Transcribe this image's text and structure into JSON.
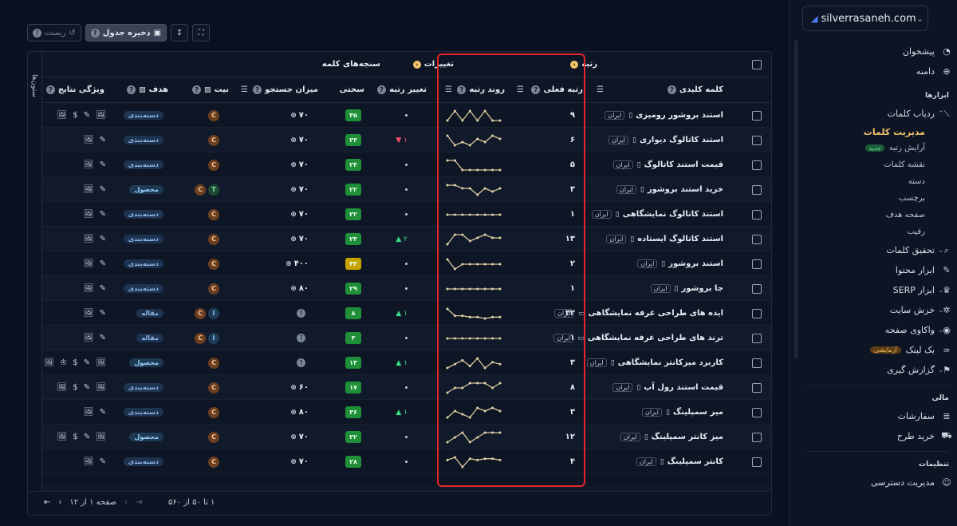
{
  "site": {
    "name": "silverrasaneh.com"
  },
  "sidebar": {
    "top_items": [
      {
        "label": "پیشخوان",
        "icon": "pie-chart-icon"
      },
      {
        "label": "دامنه",
        "icon": "globe-icon"
      }
    ],
    "tools_section": "ابزارها",
    "keyword_tracker": {
      "label": "ردیاب کلمات",
      "icon": "chart-line-icon",
      "subitems": [
        {
          "label": "مدیریت کلمات",
          "active": true
        },
        {
          "label": "آرایش رتبه",
          "badge": "جدید"
        },
        {
          "label": "نقشه کلمات"
        },
        {
          "label": "دسته"
        },
        {
          "label": "برچسب"
        },
        {
          "label": "صفحه هدف"
        },
        {
          "label": "رقیب"
        }
      ]
    },
    "tool_items": [
      {
        "label": "تحقیق کلمات",
        "icon": "search-icon",
        "caret": true
      },
      {
        "label": "ابزار محتوا",
        "icon": "pen-icon",
        "caret": false
      },
      {
        "label": "ابزار SERP",
        "icon": "trophy-icon",
        "caret": true
      },
      {
        "label": "خزش سایت",
        "icon": "spider-icon",
        "caret": true
      },
      {
        "label": "واکاوی صفحه",
        "icon": "gauge-icon",
        "caret": true
      },
      {
        "label": "بک لینک",
        "icon": "link-icon",
        "caret": false,
        "badge": "آزمایشی"
      },
      {
        "label": "گزارش گیری",
        "icon": "flag-icon",
        "caret": true
      }
    ],
    "finance_section": "مالی",
    "finance_items": [
      {
        "label": "سفارشات",
        "icon": "list-icon"
      },
      {
        "label": "خرید طرح",
        "icon": "cart-icon"
      }
    ],
    "settings_section": "تنظیمات",
    "settings_items": [
      {
        "label": "مدیریت دسترسی",
        "icon": "users-icon"
      }
    ]
  },
  "toolbar": {
    "reset_label": "ریست",
    "save_label": "ذخیره جدول"
  },
  "table": {
    "columns_tab": "ستون‌ها",
    "groups": {
      "rank": "رتبه",
      "changes": "تغییرات",
      "metrics": "سنجه‌های کلمه"
    },
    "headers": {
      "keyword": "کلمه کلیدی",
      "current_rank": "رتبه فعلی",
      "rank_trend": "روند رتبه",
      "rank_change": "تغییر رتبه",
      "difficulty": "سختی",
      "search_volume": "میزان جستجو",
      "intent": "نیت",
      "target": "هدف",
      "serp_features": "ویژگی نتایج"
    },
    "rows": [
      {
        "keyword": "استند بروشور رومیزی",
        "location": "ایران",
        "device": "mobile",
        "rank": "۹",
        "change": "•",
        "dir": "none",
        "kd": "۴۵",
        "kdcolor": "#1f8f3a",
        "volume": "۷۰",
        "intent": [
          "C"
        ],
        "target": "دسته‌بندی",
        "target_type": "cat",
        "features": "🖼 ✎ $ 🖼",
        "trend": [
          9,
          8,
          9,
          8,
          9,
          8,
          9,
          9
        ]
      },
      {
        "keyword": "استند کاتالوگ دیواری",
        "location": "ایران",
        "device": "mobile",
        "rank": "۶",
        "change": "۱",
        "dir": "down",
        "kd": "۲۳",
        "kdcolor": "#1f8f3a",
        "volume": "۷۰",
        "intent": [
          "C"
        ],
        "target": "دسته‌بندی",
        "target_type": "cat",
        "features": "✎ 🖼",
        "trend": [
          5,
          8,
          7,
          8,
          6,
          7,
          5,
          6
        ]
      },
      {
        "keyword": "قیمت استند کاتالوگ",
        "location": "ایران",
        "device": "mobile",
        "rank": "۵",
        "change": "•",
        "dir": "none",
        "kd": "۲۴",
        "kdcolor": "#1f8f3a",
        "volume": "۷۰",
        "intent": [
          "C"
        ],
        "target": "دسته‌بندی",
        "target_type": "cat",
        "features": "✎ 🖼",
        "trend": [
          2,
          2,
          6,
          6,
          6,
          6,
          6,
          6
        ]
      },
      {
        "keyword": "خرید استند بروشور",
        "location": "ایران",
        "device": "mobile",
        "rank": "۳",
        "change": "•",
        "dir": "none",
        "kd": "۲۲",
        "kdcolor": "#1f8f3a",
        "volume": "۷۰",
        "intent": [
          "T",
          "C"
        ],
        "target": "محصول",
        "target_type": "prod",
        "features": "✎ 🖼",
        "trend": [
          3,
          3,
          4,
          4,
          6,
          4,
          5,
          4
        ]
      },
      {
        "keyword": "استند کاتالوگ نمایشگاهی",
        "location": "ایران",
        "device": "mobile",
        "rank": "۱",
        "change": "•",
        "dir": "none",
        "kd": "۲۲",
        "kdcolor": "#1f8f3a",
        "volume": "۷۰",
        "intent": [
          "C"
        ],
        "target": "دسته‌بندی",
        "target_type": "cat",
        "features": "✎ 🖼",
        "trend": [
          1,
          1,
          1,
          1,
          1,
          1,
          1,
          1
        ]
      },
      {
        "keyword": "استند کاتالوگ ایستاده",
        "location": "ایران",
        "device": "mobile",
        "rank": "۱۳",
        "change": "۲",
        "dir": "up",
        "kd": "۲۴",
        "kdcolor": "#1f8f3a",
        "volume": "۷۰",
        "intent": [
          "C"
        ],
        "target": "دسته‌بندی",
        "target_type": "cat",
        "features": "✎ 🖼",
        "trend": [
          15,
          12,
          12,
          14,
          13,
          12,
          13,
          13
        ]
      },
      {
        "keyword": "استند بروشور",
        "location": "ایران",
        "device": "mobile",
        "rank": "۲",
        "change": "•",
        "dir": "none",
        "kd": "۳۳",
        "kdcolor": "#c9a400",
        "volume": "۴۰۰",
        "intent": [
          "C"
        ],
        "target": "دسته‌بندی",
        "target_type": "cat",
        "features": "✎ 🖼",
        "trend": [
          1,
          3,
          2,
          2,
          2,
          2,
          2,
          2
        ]
      },
      {
        "keyword": "جا بروشور",
        "location": "ایران",
        "device": "mobile",
        "rank": "۱",
        "change": "•",
        "dir": "none",
        "kd": "۲۹",
        "kdcolor": "#1f8f3a",
        "volume": "۸۰",
        "intent": [
          "C"
        ],
        "target": "دسته‌بندی",
        "target_type": "cat",
        "features": "✎ 🖼",
        "trend": [
          1,
          1,
          1,
          1,
          1,
          1,
          1,
          1
        ]
      },
      {
        "keyword": "ایده های طراحی غرفه نمایشگاهی",
        "location": "ایران",
        "device": "desktop",
        "rank": "۴۲",
        "change": "۱",
        "dir": "up",
        "kd": "۸",
        "kdcolor": "#1f8f3a",
        "volume": "",
        "intent": [
          "I",
          "C"
        ],
        "target": "مقاله",
        "target_type": "art",
        "features": "✎ 🖼",
        "trend": [
          40,
          45,
          45,
          46,
          46,
          47,
          46,
          46
        ]
      },
      {
        "keyword": "ترند های طراحی غرفه نمایشگاهی",
        "location": "ایران",
        "device": "desktop",
        "rank": "۱",
        "change": "•",
        "dir": "none",
        "kd": "۳",
        "kdcolor": "#1f8f3a",
        "volume": "",
        "intent": [
          "I",
          "C"
        ],
        "target": "مقاله",
        "target_type": "art",
        "features": "✎ 🖼",
        "trend": [
          1,
          1,
          1,
          1,
          1,
          1,
          1,
          1
        ]
      },
      {
        "keyword": "کاربرد میزکانتر نمایشگاهی",
        "location": "ایران",
        "device": "mobile",
        "rank": "۳",
        "change": "۱",
        "dir": "up",
        "kd": "۱۴",
        "kdcolor": "#1f8f3a",
        "volume": "",
        "intent": [
          "C"
        ],
        "target": "محصول",
        "target_type": "prod",
        "features": "🖼 ✎ $ ♔ 🖼",
        "trend": [
          6,
          4,
          2,
          5,
          1,
          6,
          3,
          4
        ]
      },
      {
        "keyword": "قیمت استند رول آپ",
        "location": "ایران",
        "device": "mobile",
        "rank": "۸",
        "change": "•",
        "dir": "none",
        "kd": "۱۷",
        "kdcolor": "#1f8f3a",
        "volume": "۶۰",
        "intent": [
          "C"
        ],
        "target": "دسته‌بندی",
        "target_type": "cat",
        "features": "🖼 ✎ $ 🖼",
        "trend": [
          9,
          8,
          8,
          7,
          7,
          7,
          8,
          7
        ]
      },
      {
        "keyword": "میز سمپلینگ",
        "location": "ایران",
        "device": "mobile",
        "rank": "۳",
        "change": "۱",
        "dir": "up",
        "kd": "۳۶",
        "kdcolor": "#1f8f3a",
        "volume": "۸۰",
        "intent": [
          "C"
        ],
        "target": "دسته‌بندی",
        "target_type": "cat",
        "features": "✎ 🖼",
        "trend": [
          5,
          3,
          4,
          5,
          2,
          3,
          2,
          3
        ]
      },
      {
        "keyword": "میز کانتر سمپلینگ",
        "location": "ایران",
        "device": "mobile",
        "rank": "۱۲",
        "change": "•",
        "dir": "none",
        "kd": "۲۲",
        "kdcolor": "#1f8f3a",
        "volume": "۷۰",
        "intent": [
          "C"
        ],
        "target": "محصول",
        "target_type": "prod",
        "features": "🖼 ✎ $ 🖼",
        "trend": [
          14,
          13,
          12,
          14,
          13,
          12,
          12,
          12
        ]
      },
      {
        "keyword": "کانتر سمپلینگ",
        "location": "ایران",
        "device": "mobile",
        "rank": "۴",
        "change": "•",
        "dir": "none",
        "kd": "۲۸",
        "kdcolor": "#1f8f3a",
        "volume": "۷۰",
        "intent": [
          "C"
        ],
        "target": "دسته‌بندی",
        "target_type": "cat",
        "features": "✎ 🖼",
        "trend": [
          4,
          2,
          9,
          3,
          4,
          3,
          3,
          4
        ]
      }
    ]
  },
  "footer": {
    "range": "۱ تا ۵۰ از ۵۶۰",
    "page": "صفحه ۱ از ۱۲"
  }
}
